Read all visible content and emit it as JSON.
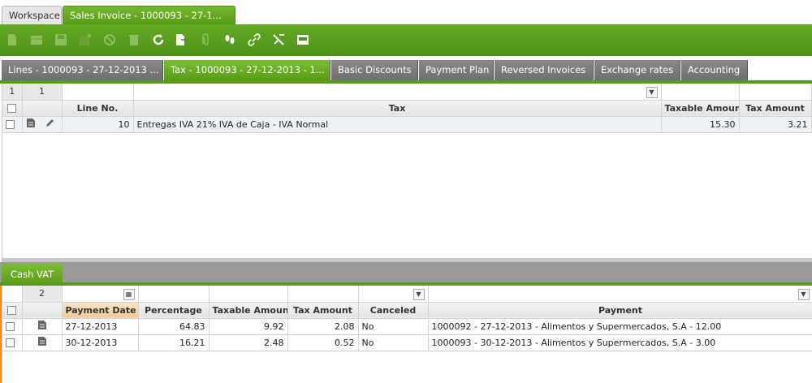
{
  "window_tabs": {
    "workspace": "Workspace",
    "sales_invoice": "Sales Invoice - 1000093 - 27-1..."
  },
  "record_tabs": [
    "Lines - 1000093 - 27-12-2013 ...",
    "Tax - 1000093 - 27-12-2013 - 1...",
    "Basic Discounts",
    "Payment Plan",
    "Reversed Invoices",
    "Exchange rates",
    "Accounting"
  ],
  "tax_grid": {
    "counter_left": "1",
    "counter_right": "1",
    "headers": {
      "line_no": "Line No.",
      "tax": "Tax",
      "taxable_amount": "Taxable Amount",
      "tax_amount": "Tax Amount"
    },
    "rows": [
      {
        "line_no": "10",
        "tax": "Entregas IVA 21% IVA de Caja - IVA Normal",
        "taxable_amount": "15.30",
        "tax_amount": "3.21"
      }
    ]
  },
  "sub_tab": "Cash VAT",
  "cash_vat_grid": {
    "counter": "2",
    "headers": {
      "payment_date": "Payment Date",
      "percentage": "Percentage",
      "taxable_amount": "Taxable Amount",
      "tax_amount": "Tax Amount",
      "canceled": "Canceled",
      "payment": "Payment"
    },
    "rows": [
      {
        "payment_date": "27-12-2013",
        "percentage": "64.83",
        "taxable_amount": "9.92",
        "tax_amount": "2.08",
        "canceled": "No",
        "payment": "1000092 - 27-12-2013 - Alimentos y Supermercados, S.A - 12.00"
      },
      {
        "payment_date": "30-12-2013",
        "percentage": "16.21",
        "taxable_amount": "2.48",
        "tax_amount": "0.52",
        "canceled": "No",
        "payment": "1000093 - 30-12-2013 - Alimentos y Supermercados, S.A - 3.00"
      }
    ]
  },
  "colors": {
    "accent_green": "#5a9a1a",
    "sort_orange": "#f08a1c"
  }
}
